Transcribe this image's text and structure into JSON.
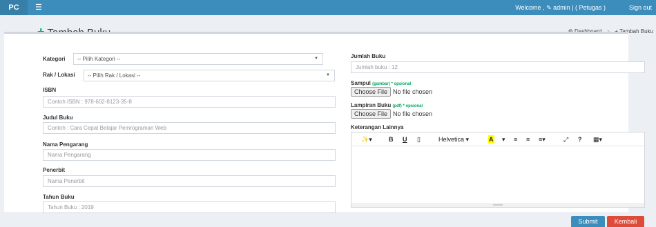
{
  "topbar": {
    "brand": "PC",
    "welcome_prefix": "Welcome ,",
    "welcome_user": "admin | ( Petugas )",
    "signout": "Sign out"
  },
  "sidebar": {
    "icons": [
      "dashboard-icon",
      "user-icon",
      "edit-icon",
      "exchange-icon",
      "idcard-icon"
    ]
  },
  "header": {
    "title": "Tambah Buku",
    "breadcrumb": [
      "Dashboard",
      "Tambah Buku"
    ]
  },
  "form": {
    "kategori": {
      "label": "Kategori",
      "selected": "-- Pilih Kategori --"
    },
    "rak": {
      "label": "Rak / Lokasi",
      "selected": "-- Pilih Rak / Lokasi --"
    },
    "isbn": {
      "label": "ISBN",
      "placeholder": "Contoh ISBN : 978-602-8123-35-8"
    },
    "judul": {
      "label": "Judul Buku",
      "placeholder": "Contoh : Cara Cepat Belajar Pemrograman Web"
    },
    "pengarang": {
      "label": "Nama Pengarang",
      "placeholder": "Nama Pengarang"
    },
    "penerbit": {
      "label": "Penerbit",
      "placeholder": "Nama Penerbit"
    },
    "tahun": {
      "label": "Tahun Buku",
      "placeholder": "Tahun Buku : 2019"
    },
    "jumlah": {
      "label": "Jumlah Buku",
      "placeholder": "Jumlah buku : 12"
    },
    "sampul": {
      "label": "Sampul",
      "hint": "(gambar) * opsional",
      "button": "Choose File",
      "status": "No file chosen"
    },
    "lampiran": {
      "label": "Lampiran Buku",
      "hint": "(pdf) * opsional",
      "button": "Choose File",
      "status": "No file chosen"
    },
    "keterangan": {
      "label": "Keterangan Lainnya"
    }
  },
  "editor": {
    "font": "Helvetica",
    "bold": "B",
    "underline": "U",
    "help": "?"
  },
  "actions": {
    "submit": "Submit",
    "back": "Kembali"
  },
  "colors": {
    "topbar": "#3c8dbc",
    "brand_bg": "#367fa9",
    "submit": "#3c8dbc",
    "back": "#dd4b39",
    "accent_green": "#00a65a"
  }
}
